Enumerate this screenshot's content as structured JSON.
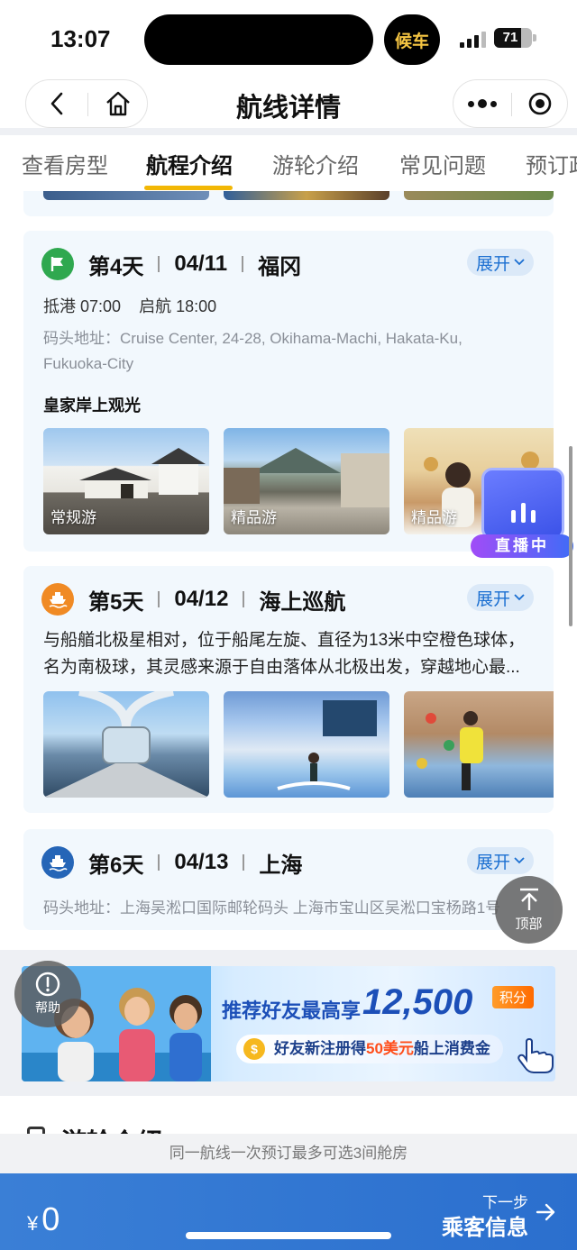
{
  "status_bar": {
    "time": "13:07",
    "carpool": "候车",
    "battery": "71",
    "battery_level": 0.71
  },
  "nav": {
    "title": "航线详情"
  },
  "tabs": [
    {
      "label": "查看房型",
      "active": false
    },
    {
      "label": "航程介绍",
      "active": true
    },
    {
      "label": "游轮介绍",
      "active": false
    },
    {
      "label": "常见问题",
      "active": false
    },
    {
      "label": "预订政",
      "active": false
    }
  ],
  "days": [
    {
      "day": "第4天",
      "date": "04/11",
      "port": "福冈",
      "expand_label": "展开",
      "arrive_label": "抵港",
      "arrive_time": "07:00",
      "depart_label": "启航",
      "depart_time": "18:00",
      "address": "码头地址：Cruise Center, 24-28, Okihama-Machi, Hakata-Ku, Fukuoka-City",
      "tour_section": "皇家岸上观光",
      "photos": [
        {
          "tag": "常规游"
        },
        {
          "tag": "精品游"
        },
        {
          "tag": "精品游"
        }
      ]
    },
    {
      "day": "第5天",
      "date": "04/12",
      "port": "海上巡航",
      "expand_label": "展开",
      "description": "与船艏北极星相对，位于船尾左旋、直径为13米中空橙色球体，名为南极球，其灵感来源于自由落体从北极出发，穿越地心最..."
    },
    {
      "day": "第6天",
      "date": "04/13",
      "port": "上海",
      "expand_label": "展开",
      "address": "码头地址：上海吴淞口国际邮轮码头 上海市宝山区吴淞口宝杨路1号"
    }
  ],
  "live_badge": {
    "label": "直播中"
  },
  "top_button": {
    "label": "顶部"
  },
  "help_button": {
    "label": "帮助"
  },
  "banner": {
    "headline": "推荐好友最高享",
    "amount": "12,500",
    "points": "积分",
    "sub_prefix": "好友新注册得",
    "sub_highlight": "50美元",
    "sub_suffix": "船上消费金",
    "coin": "$"
  },
  "ship_section": {
    "title": "游轮介绍"
  },
  "notice": "同一航线一次预订最多可选3间舱房",
  "bottom_bar": {
    "currency": "¥",
    "price": "0",
    "next_sub": "下一步",
    "next_main": "乘客信息"
  },
  "colors": {
    "accent_yellow": "#f2b705",
    "primary_blue": "#2b6fce",
    "card_bg": "#f2f8fd",
    "day4_icon": "#2fa84f",
    "day5_icon": "#f08a24",
    "day6_icon": "#2565b7"
  }
}
